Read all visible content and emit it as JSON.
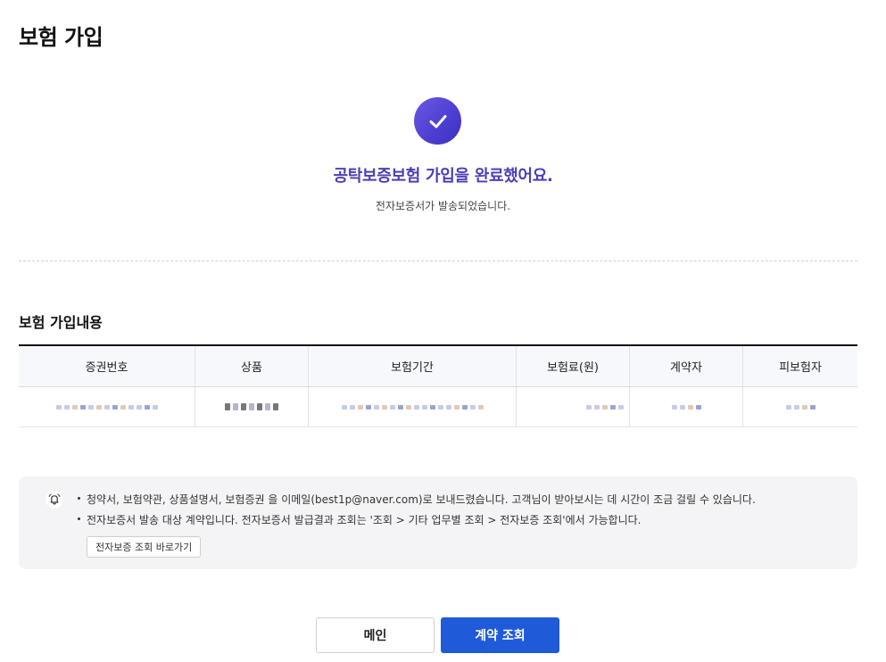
{
  "page": {
    "title": "보험 가입"
  },
  "result": {
    "icon": "check-icon",
    "title": "공탁보증보험 가입을 완료했어요.",
    "subtitle": "전자보증서가 발송되었습니다."
  },
  "section": {
    "title": "보험 가입내용"
  },
  "table": {
    "headers": [
      "증권번호",
      "상품",
      "보험기간",
      "보험료(원)",
      "계약자",
      "피보험자"
    ]
  },
  "notice": {
    "icon": "bell-icon",
    "lines": [
      "청약서, 보험약관, 상품설명서, 보험증권 을 이메일(best1p@naver.com)로 보내드렸습니다. 고객님이 받아보시는 데 시간이 조금 걸릴 수 있습니다.",
      "전자보증서 발송 대상 계약입니다. 전자보증서 발급결과 조회는 '조회 > 기타 업무별 조회 > 전자보증 조회'에서 가능합니다."
    ],
    "shortcut_label": "전자보증 조회 바로가기"
  },
  "buttons": {
    "main_label": "메인",
    "contract_label": "계약 조회"
  },
  "colors": {
    "primary": "#1f5bd8",
    "accent": "#4a3fb8"
  }
}
